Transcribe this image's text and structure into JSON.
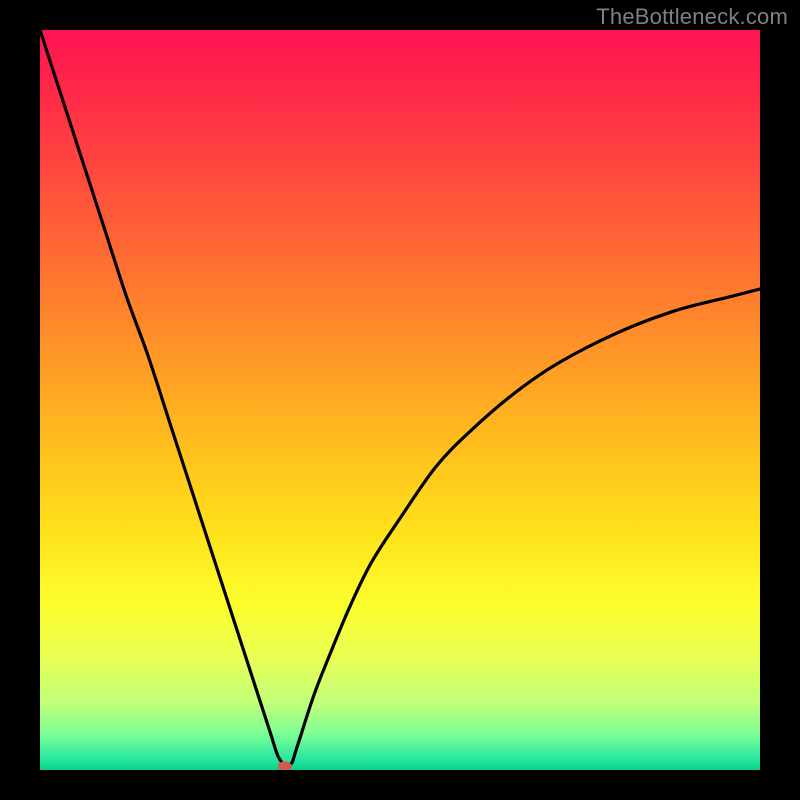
{
  "watermark": "TheBottleneck.com",
  "chart_data": {
    "type": "line",
    "title": "",
    "xlabel": "",
    "ylabel": "",
    "xlim": [
      0,
      100
    ],
    "ylim": [
      0,
      100
    ],
    "grid": false,
    "legend": false,
    "background_gradient_stops": [
      {
        "pos": 0.0,
        "color": "#ff1452"
      },
      {
        "pos": 0.1,
        "color": "#ff2d47"
      },
      {
        "pos": 0.25,
        "color": "#ff5a38"
      },
      {
        "pos": 0.4,
        "color": "#ff8a2a"
      },
      {
        "pos": 0.55,
        "color": "#ffbb1e"
      },
      {
        "pos": 0.68,
        "color": "#ffe21a"
      },
      {
        "pos": 0.78,
        "color": "#fcff2e"
      },
      {
        "pos": 0.85,
        "color": "#e8ff55"
      },
      {
        "pos": 0.91,
        "color": "#c0ff7a"
      },
      {
        "pos": 0.95,
        "color": "#80ff95"
      },
      {
        "pos": 0.985,
        "color": "#28e8a0"
      },
      {
        "pos": 1.0,
        "color": "#09d089"
      }
    ],
    "series": [
      {
        "name": "bottleneck-curve",
        "color": "#000000",
        "x": [
          0,
          3,
          6,
          9,
          12,
          15,
          18,
          21,
          24,
          27,
          30,
          32,
          33,
          34,
          34.1,
          34.2,
          34.3,
          35,
          35.5,
          36,
          38,
          40,
          43,
          46,
          50,
          55,
          60,
          66,
          72,
          80,
          88,
          96,
          100
        ],
        "y": [
          100,
          91,
          82,
          73,
          64,
          56,
          47,
          38,
          29,
          20,
          11,
          5,
          2,
          0.5,
          0.5,
          0.5,
          0.5,
          1,
          2.5,
          4,
          10,
          15,
          22,
          28,
          34,
          41,
          46,
          51,
          55,
          59,
          62,
          64,
          65
        ]
      }
    ],
    "marker": {
      "name": "optimal-point",
      "x": 34,
      "y": 0.5,
      "color": "#d05a50",
      "rx": 7,
      "ry": 5
    }
  }
}
